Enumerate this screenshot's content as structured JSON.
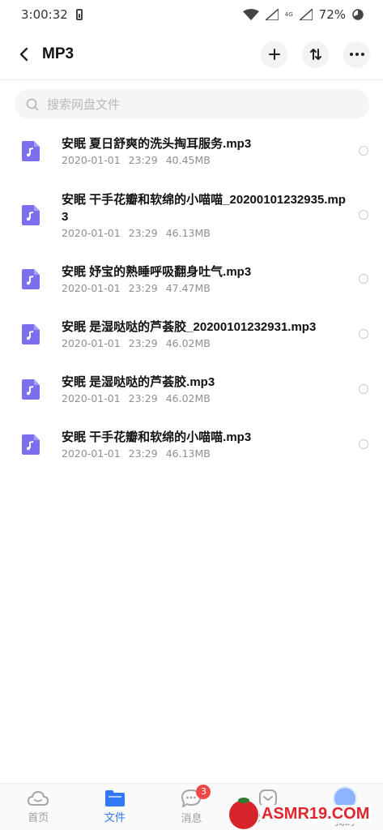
{
  "status_bar": {
    "time": "3:00:32",
    "network": "4G",
    "battery": "72%"
  },
  "header": {
    "title": "MP3"
  },
  "search": {
    "placeholder": "搜索网盘文件"
  },
  "files": [
    {
      "name": "安眠 夏日舒爽的洗头掏耳服务.mp3",
      "date": "2020-01-01",
      "time": "23:29",
      "size": "40.45MB"
    },
    {
      "name": "安眠 干手花瓣和软绵的小喵喵_20200101232935.mp3",
      "date": "2020-01-01",
      "time": "23:29",
      "size": "46.13MB"
    },
    {
      "name": "安眠 妤宝的熟睡呼吸翻身吐气.mp3",
      "date": "2020-01-01",
      "time": "23:29",
      "size": "47.47MB"
    },
    {
      "name": "安眠 是湿哒哒的芦荟胶_20200101232931.mp3",
      "date": "2020-01-01",
      "time": "23:29",
      "size": "46.02MB"
    },
    {
      "name": "安眠 是湿哒哒的芦荟胶.mp3",
      "date": "2020-01-01",
      "time": "23:29",
      "size": "46.02MB"
    },
    {
      "name": "安眠 干手花瓣和软绵的小喵喵.mp3",
      "date": "2020-01-01",
      "time": "23:29",
      "size": "46.13MB"
    }
  ],
  "bottom_nav": {
    "home": "首页",
    "files": "文件",
    "messages": "消息",
    "messages_badge": "3",
    "discover": "发现",
    "me": "我的"
  },
  "watermark": {
    "text": "ASMR19.COM"
  },
  "colors": {
    "accent": "#3478f6",
    "file_icon": "#7b6ff0",
    "badge": "#f24848"
  }
}
